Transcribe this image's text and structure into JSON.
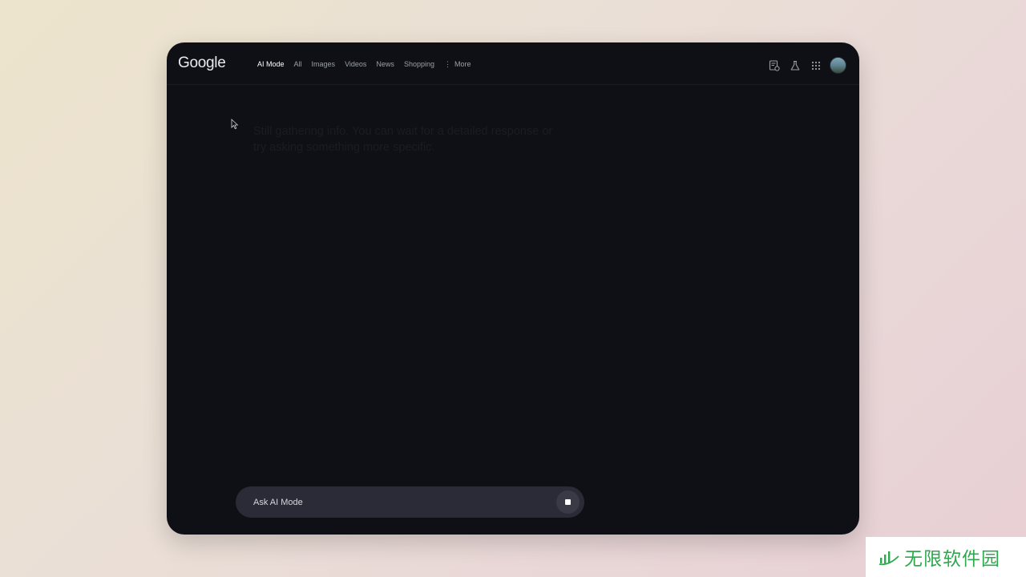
{
  "app": {
    "logo_text": "Google"
  },
  "nav": {
    "tabs": [
      {
        "label": "AI Mode",
        "active": true
      },
      {
        "label": "All",
        "active": false
      },
      {
        "label": "Images",
        "active": false
      },
      {
        "label": "Videos",
        "active": false
      },
      {
        "label": "News",
        "active": false
      },
      {
        "label": "Shopping",
        "active": false
      }
    ],
    "more_label": "More"
  },
  "header_icons": [
    "history-icon",
    "labs-flask-icon",
    "apps-grid-icon",
    "account-avatar"
  ],
  "main": {
    "loading_text": "Still gathering info. You can wait for a detailed response or try asking something more specific."
  },
  "ask_bar": {
    "placeholder": "Ask AI Mode",
    "value": ""
  },
  "watermark": {
    "text": "无限软件园"
  },
  "colors": {
    "window_bg": "#0f1015",
    "ask_bar_bg": "#2a2b36",
    "watermark_green": "#2fa84f"
  }
}
